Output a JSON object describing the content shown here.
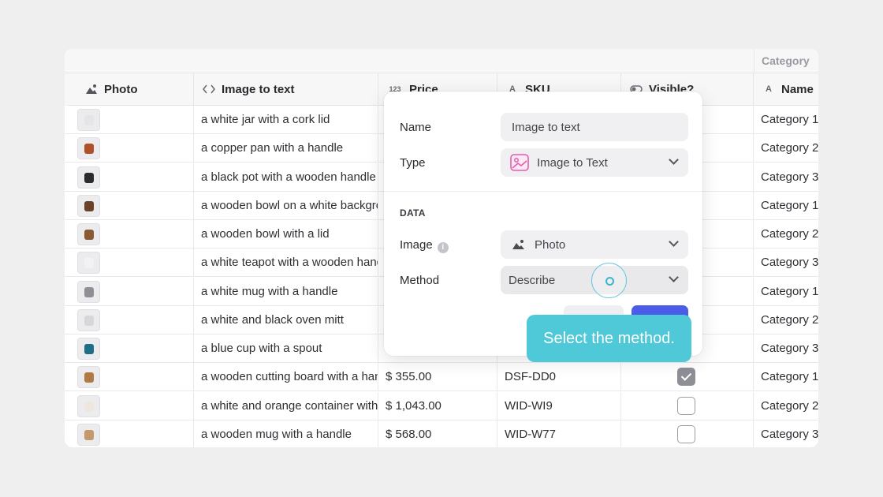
{
  "table": {
    "group_header": "Category",
    "columns": [
      {
        "label": "Photo",
        "icon": "photo-icon"
      },
      {
        "label": "Image to text",
        "icon": "code-icon"
      },
      {
        "label": "Price",
        "icon": "number-icon",
        "icon_text": "123"
      },
      {
        "label": "SKU",
        "icon": "text-icon",
        "icon_text": "A"
      },
      {
        "label": "Visible?",
        "icon": "toggle-icon"
      },
      {
        "label": "Name",
        "icon": "text-icon",
        "icon_text": "A"
      }
    ],
    "rows": [
      {
        "thumb": "#e5e5e8",
        "text": "a white jar with a cork lid",
        "price": "",
        "sku": "",
        "visible": null,
        "category": "Category 1"
      },
      {
        "thumb": "#b0502a",
        "text": "a copper pan with a handle",
        "price": "",
        "sku": "",
        "visible": null,
        "category": "Category 2"
      },
      {
        "thumb": "#2b2b2b",
        "text": "a black pot with a wooden handle",
        "price": "",
        "sku": "",
        "visible": null,
        "category": "Category 3"
      },
      {
        "thumb": "#6b4228",
        "text": "a wooden bowl on a white background",
        "price": "",
        "sku": "",
        "visible": null,
        "category": "Category 1"
      },
      {
        "thumb": "#8a5a35",
        "text": "a wooden bowl with a lid",
        "price": "",
        "sku": "",
        "visible": null,
        "category": "Category 2"
      },
      {
        "thumb": "#f2f2f2",
        "text": "a white teapot with a wooden handle",
        "price": "",
        "sku": "",
        "visible": null,
        "category": "Category 3"
      },
      {
        "thumb": "#8f8f95",
        "text": "a white mug with a handle",
        "price": "",
        "sku": "",
        "visible": null,
        "category": "Category 1"
      },
      {
        "thumb": "#d7d7da",
        "text": "a white and black oven mitt",
        "price": "",
        "sku": "",
        "visible": null,
        "category": "Category 2"
      },
      {
        "thumb": "#1e6f86",
        "text": "a blue cup with a spout",
        "price": "",
        "sku": "",
        "visible": null,
        "category": "Category 3"
      },
      {
        "thumb": "#b07a45",
        "text": "a wooden cutting board with a handle",
        "price": "$ 355.00",
        "sku": "DSF-DD0",
        "visible": true,
        "category": "Category 1"
      },
      {
        "thumb": "#efe7de",
        "text": "a white and orange container with a lid",
        "price": "$ 1,043.00",
        "sku": "WID-WI9",
        "visible": false,
        "category": "Category 2"
      },
      {
        "thumb": "#c49a6c",
        "text": "a wooden mug with a handle",
        "price": "$ 568.00",
        "sku": "WID-W77",
        "visible": false,
        "category": "Category 3"
      }
    ]
  },
  "modal": {
    "name_label": "Name",
    "name_value": "Image to text",
    "type_label": "Type",
    "type_value": "Image to Text",
    "section_title": "DATA",
    "image_label": "Image",
    "image_value": "Photo",
    "method_label": "Method",
    "method_value": "Describe"
  },
  "tooltip": {
    "text": "Select the method."
  },
  "colors": {
    "accent": "#4b5de8",
    "tooltip": "#4fc8d8",
    "type_icon": "#e05fb0"
  }
}
